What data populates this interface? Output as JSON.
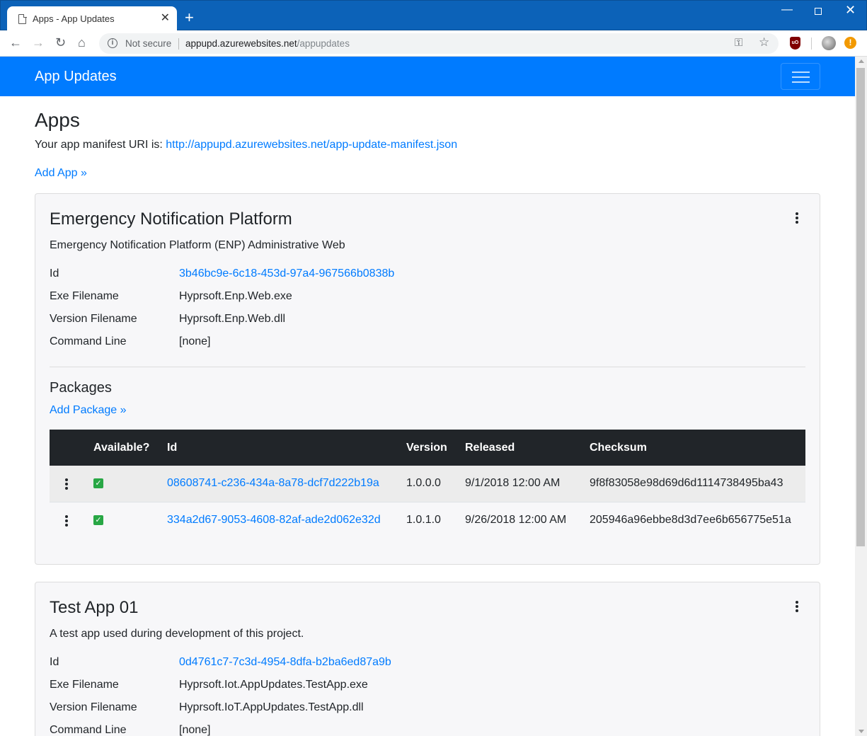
{
  "browser": {
    "tab_title": "Apps - App Updates",
    "tab_close": "✕",
    "new_tab": "+",
    "security_label": "Not secure",
    "url_host": "appupd.azurewebsites.net",
    "url_path": "/appupdates",
    "ublock_label": "uO",
    "update_badge": "!"
  },
  "navbar": {
    "brand": "App Updates"
  },
  "page": {
    "heading": "Apps",
    "manifest_prefix": "Your app manifest URI is: ",
    "manifest_url": "http://appupd.azurewebsites.net/app-update-manifest.json",
    "add_app": "Add App »"
  },
  "labels": {
    "id": "Id",
    "exe": "Exe Filename",
    "version": "Version Filename",
    "cmd": "Command Line",
    "packages": "Packages",
    "add_package": "Add Package »"
  },
  "apps": [
    {
      "name": "Emergency Notification Platform",
      "description": "Emergency Notification Platform (ENP) Administrative Web",
      "id": "3b46bc9e-6c18-453d-97a4-967566b0838b",
      "exe": "Hyprsoft.Enp.Web.exe",
      "version": "Hyprsoft.Enp.Web.dll",
      "cmd": "[none]",
      "packages": {
        "columns": [
          "Available?",
          "Id",
          "Version",
          "Released",
          "Checksum"
        ],
        "rows": [
          {
            "available": true,
            "id": "08608741-c236-434a-8a78-dcf7d222b19a",
            "version": "1.0.0.0",
            "released": "9/1/2018 12:00 AM",
            "checksum": "9f8f83058e98d69d6d1114738495ba43"
          },
          {
            "available": true,
            "id": "334a2d67-9053-4608-82af-ade2d062e32d",
            "version": "1.0.1.0",
            "released": "9/26/2018 12:00 AM",
            "checksum": "205946a96ebbe8d3d7ee6b656775e51a"
          }
        ]
      }
    },
    {
      "name": "Test App 01",
      "description": "A test app used during development of this project.",
      "id": "0d4761c7-7c3d-4954-8dfa-b2ba6ed87a9b",
      "exe": "Hyprsoft.Iot.AppUpdates.TestApp.exe",
      "version": "Hyprsoft.IoT.AppUpdates.TestApp.dll",
      "cmd": "[none]"
    }
  ],
  "colors": {
    "primary": "#007bff",
    "dark": "#212529",
    "success": "#28a745",
    "chrome": "#0c62b8"
  }
}
